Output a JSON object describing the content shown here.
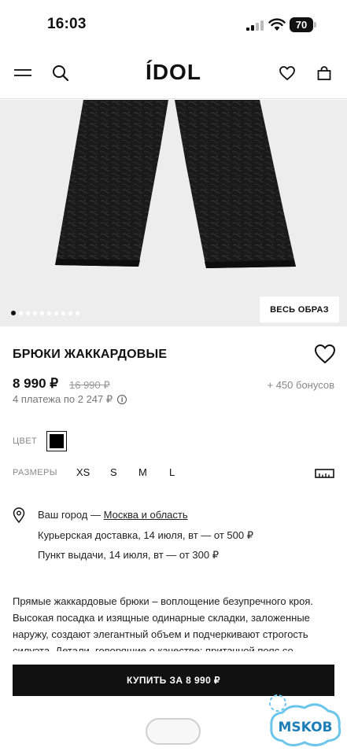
{
  "status_bar": {
    "time": "16:03",
    "battery": "70"
  },
  "header": {
    "logo": "ÍDOL"
  },
  "gallery": {
    "look_button": "ВЕСЬ ОБРАЗ",
    "slide_count": 10,
    "active_slide": 1
  },
  "product": {
    "title": "БРЮКИ ЖАККАРДОВЫЕ",
    "price": "8 990 ₽",
    "old_price": "16 990 ₽",
    "bonus": "+ 450 бонусов",
    "installments": "4 платежа по 2 247 ₽"
  },
  "options": {
    "color_label": "ЦВЕТ",
    "color_value": "#000000",
    "size_label": "РАЗМЕРЫ",
    "sizes": [
      "XS",
      "S",
      "M",
      "L"
    ]
  },
  "delivery": {
    "city_prefix": "Ваш город — ",
    "city": "Москва и область",
    "courier": "Курьерская доставка, 14 июля, вт — от 500 ₽",
    "pickup": "Пункт выдачи, 14 июля, вт — от 300 ₽"
  },
  "description": "Прямые жаккардовые брюки – воплощение безупречного кроя. Высокая посадка и изящные одинарные складки, заложенные наружу, создают элегантный объем и подчеркивают строгость силуэта. Детали, говорящие о качестве: притачной пояс со",
  "buy_button": "КУПИТЬ ЗА 8 990 ₽",
  "watermark": "MSKOB"
}
